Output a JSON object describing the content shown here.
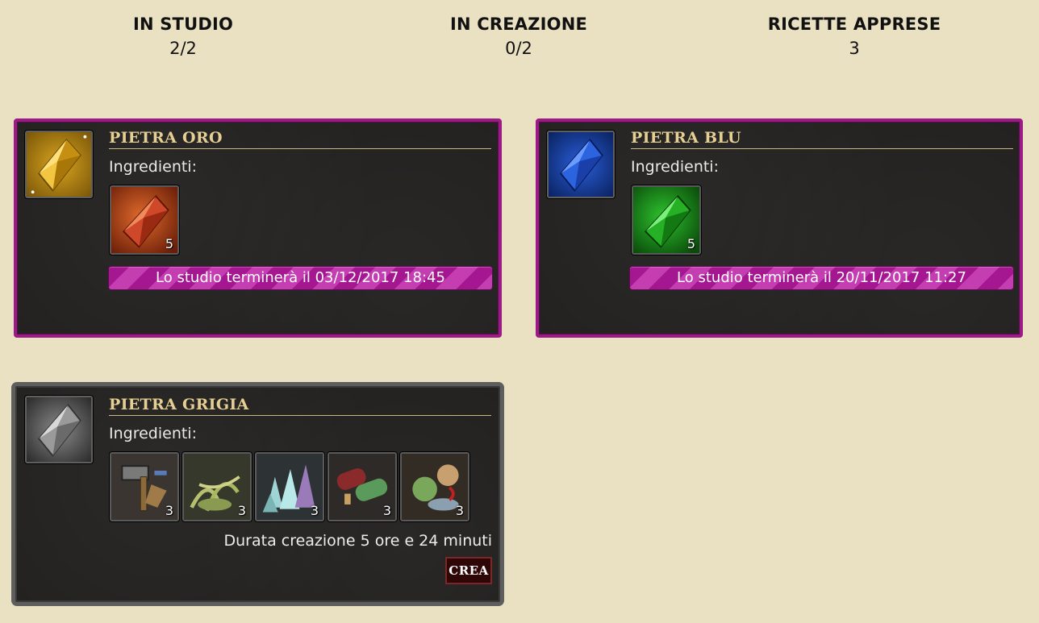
{
  "stats": [
    {
      "label": "IN STUDIO",
      "value": "2/2"
    },
    {
      "label": "IN CREAZIONE",
      "value": "0/2"
    },
    {
      "label": "RICETTE APPRESE",
      "value": "3"
    }
  ],
  "cards": [
    {
      "title": "PIETRA ORO",
      "icon": "gold-gem-icon",
      "ingredients_label": "Ingredienti:",
      "ingredients": [
        {
          "icon": "red-gem-icon",
          "qty": "5"
        }
      ],
      "status": "Lo studio terminerà il 03/12/2017 18:45"
    },
    {
      "title": "PIETRA BLU",
      "icon": "blue-gem-icon",
      "ingredients_label": "Ingredienti:",
      "ingredients": [
        {
          "icon": "green-gem-icon",
          "qty": "5"
        }
      ],
      "status": "Lo studio terminerà il 20/11/2017 11:27"
    },
    {
      "title": "PIETRA GRIGIA",
      "icon": "grey-gem-icon",
      "ingredients_label": "Ingredienti:",
      "ingredients": [
        {
          "icon": "tools-icon",
          "qty": "3"
        },
        {
          "icon": "herbs-icon",
          "qty": "3"
        },
        {
          "icon": "crystals-icon",
          "qty": "3"
        },
        {
          "icon": "scrolls-icon",
          "qty": "3"
        },
        {
          "icon": "food-icon",
          "qty": "3"
        }
      ],
      "duration": "Durata creazione 5 ore e 24 minuti",
      "button": "CREA"
    }
  ],
  "colors": {
    "background": "#e9e1c2",
    "studying_border": "#9b1a86",
    "ready_border": "#5e5e5e",
    "title": "#e6cf92",
    "button": "#2f0707"
  }
}
